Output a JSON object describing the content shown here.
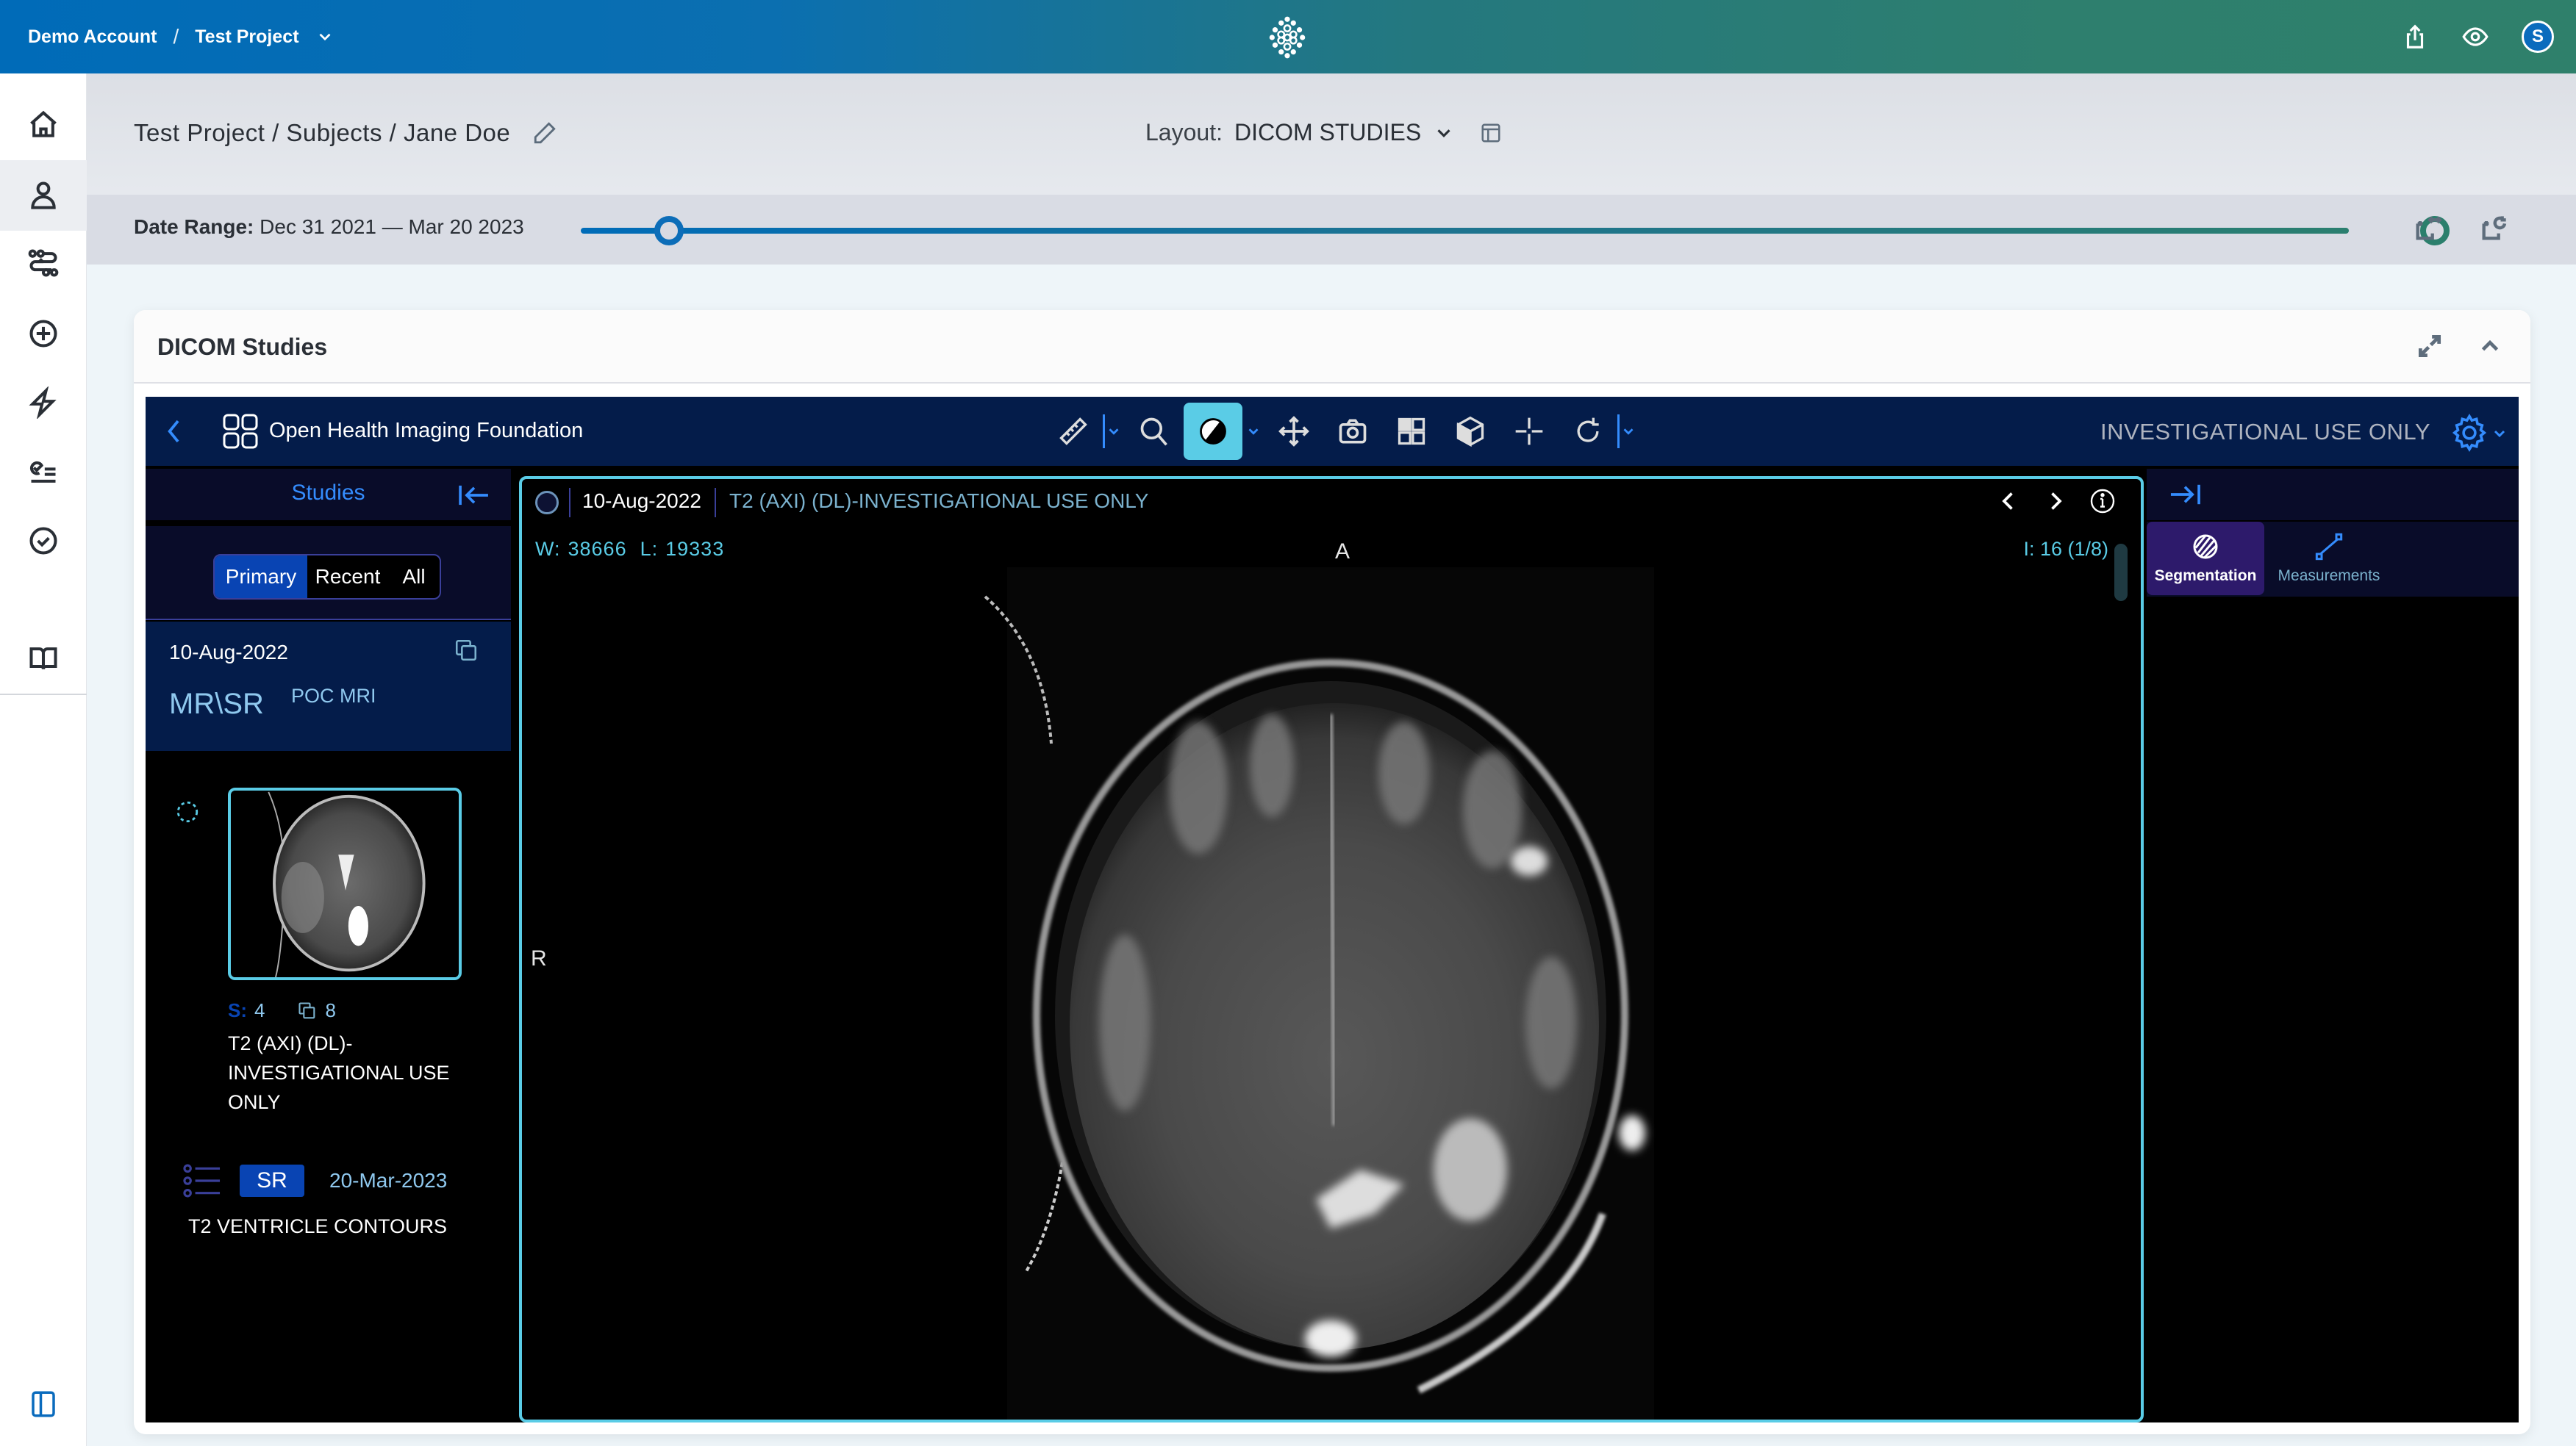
{
  "topbar": {
    "account": "Demo Account",
    "separator": "/",
    "project": "Test Project",
    "logo_icon": "app-logo-icon",
    "icons": [
      "share-icon",
      "eye-icon"
    ],
    "avatar_initial": "S"
  },
  "sidebar": {
    "items": [
      {
        "name": "home",
        "icon": "home-icon",
        "active": false
      },
      {
        "name": "subjects",
        "icon": "user-icon",
        "active": true
      },
      {
        "name": "workflows",
        "icon": "workflow-icon",
        "active": false
      },
      {
        "name": "add",
        "icon": "plus-circle-icon",
        "active": false
      },
      {
        "name": "actions",
        "icon": "lightning-icon",
        "active": false
      },
      {
        "name": "tasks",
        "icon": "checklist-icon",
        "active": false
      },
      {
        "name": "review",
        "icon": "check-circle-icon",
        "active": false
      },
      {
        "name": "docs",
        "icon": "book-icon",
        "active": false
      }
    ],
    "toggle_icon": "sidebar-toggle-icon"
  },
  "page": {
    "breadcrumb": "Test Project / Subjects / Jane Doe",
    "layout_label": "Layout:",
    "layout_value": "DICOM STUDIES"
  },
  "date_range": {
    "label": "Date Range:",
    "value": "Dec 31 2021 — Mar 20 2023",
    "slider_start_fraction": 0.0,
    "slider_end_fraction": 1.0
  },
  "card": {
    "title": "DICOM Studies"
  },
  "viewer": {
    "app_title": "Open Health Imaging Foundation",
    "tools": [
      "measure-ruler",
      "zoom",
      "window-level",
      "pan",
      "capture",
      "layout",
      "3d-view",
      "crosshairs",
      "reset-rotate"
    ],
    "active_tool": "window-level",
    "banner": "INVESTIGATIONAL USE ONLY",
    "colors": {
      "accent": "#5acce6",
      "primary": "#348cfd",
      "toolbar_bg": "#041c4a"
    }
  },
  "studies_panel": {
    "title": "Studies",
    "filters": [
      "Primary",
      "Recent",
      "All"
    ],
    "active_filter": "Primary",
    "study": {
      "date": "10-Aug-2022",
      "modalities": "MR\\SR",
      "description": "POC MRI"
    },
    "series": [
      {
        "number_label": "S:",
        "number": "4",
        "instances": "8",
        "description": "T2 (AXI) (DL)-INVESTIGATIONAL USE ONLY"
      }
    ],
    "sr": {
      "badge": "SR",
      "date": "20-Mar-2023",
      "description": "T2 VENTRICLE CONTOURS"
    }
  },
  "viewport": {
    "date": "10-Aug-2022",
    "description": "T2 (AXI) (DL)-INVESTIGATIONAL USE ONLY",
    "window_label": "W:",
    "window_value": "38666",
    "level_label": "L:",
    "level_value": "19333",
    "image_index": "I: 16 (1/8)",
    "orientation_top": "A",
    "orientation_left": "R"
  },
  "right_panel": {
    "tabs": [
      {
        "label": "Segmentation",
        "active": true
      },
      {
        "label": "Measurements",
        "active": false
      }
    ]
  }
}
